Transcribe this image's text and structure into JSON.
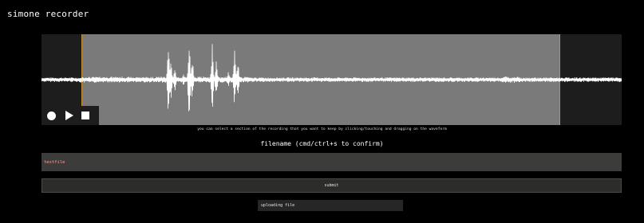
{
  "app": {
    "title": "simone recorder"
  },
  "recorder": {
    "controls": [
      {
        "name": "record",
        "icon": "record-icon"
      },
      {
        "name": "play",
        "icon": "play-icon"
      },
      {
        "name": "stop",
        "icon": "stop-icon"
      }
    ],
    "selection_start_fraction": 0.069,
    "selection_end_fraction": 0.893,
    "colors": {
      "panel_background": "#1d1d1d",
      "selection_fill": "#7a7a7a",
      "selection_handle": "#c8902e",
      "waveform": "#ffffff"
    }
  },
  "hint": "you can select a section of the recording that you want to keep by clicking/touching and dragging on the waveform",
  "filename": {
    "label": "filename (cmd/ctrl+s to confirm)",
    "value": "testfile",
    "text_color": "#ff9c9c"
  },
  "submit": {
    "label": "submit"
  },
  "upload": {
    "status": "uploading file"
  }
}
